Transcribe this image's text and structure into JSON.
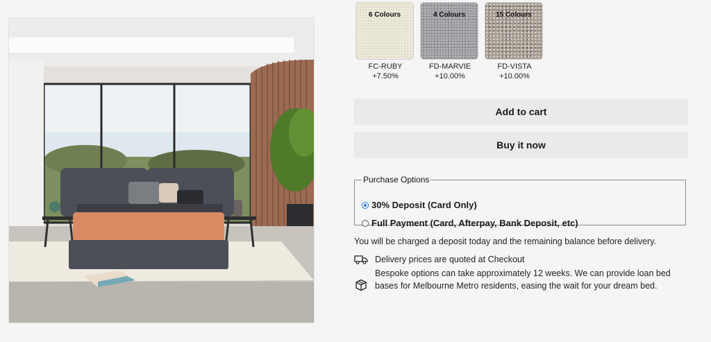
{
  "swatches": [
    {
      "count": "6 Colours",
      "name": "FC-RUBY",
      "price": "+7.50%",
      "color": "#eeeadc"
    },
    {
      "count": "4 Colours",
      "name": "FD-MARVIE",
      "price": "+10.00%",
      "color": "#9a9c9f"
    },
    {
      "count": "15 Colours",
      "name": "FD-VISTA",
      "price": "+10.00%",
      "color": "#a49c93"
    }
  ],
  "buttons": {
    "add_to_cart": "Add to cart",
    "buy_now": "Buy it now"
  },
  "purchase_options": {
    "legend": "Purchase Options",
    "options": [
      {
        "label": "30% Deposit (Card Only)",
        "selected": true
      },
      {
        "label": "Full Payment (Card, Afterpay, Bank Deposit, etc)",
        "selected": false
      }
    ]
  },
  "deposit_note": "You will be charged a deposit today and the remaining balance before delivery.",
  "info": [
    {
      "icon": "truck-icon",
      "text": "Delivery prices are quoted at Checkout"
    },
    {
      "icon": "box-icon",
      "text": "Bespoke options can take approximately 12 weeks. We can provide loan bed bases for Melbourne Metro residents, easing the wait for your dream bed."
    }
  ],
  "colors": {
    "button_bg": "#e9eaeb",
    "radio_accent": "#1a73e8",
    "page_bg": "#f5f5f5"
  }
}
